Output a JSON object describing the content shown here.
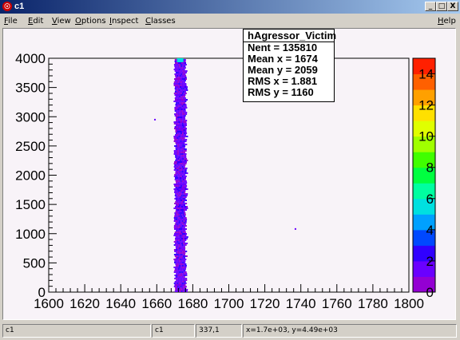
{
  "window": {
    "title": "c1",
    "min_label": "_",
    "max_label": "□",
    "close_label": "X"
  },
  "menu": {
    "file": "File",
    "edit": "Edit",
    "view": "View",
    "options": "Options",
    "inspect": "Inspect",
    "classes": "Classes",
    "help": "Help"
  },
  "stats": {
    "title": "hAgressor_Victim",
    "nent": "Nent = 135810",
    "mean_x": "Mean x =   1674",
    "mean_y": "Mean y =   2059",
    "rms_x": "RMS x  =  1.881",
    "rms_y": "RMS y  =   1160"
  },
  "status": {
    "object": "c1",
    "pad": "c1",
    "pixel": "337,1",
    "coords": "x=1.7e+03, y=4.49e+03"
  },
  "chart_data": {
    "type": "heatmap",
    "title": "",
    "xlabel": "",
    "ylabel": "",
    "xlim": [
      1600,
      1800
    ],
    "ylim": [
      0,
      4000
    ],
    "x_ticks": [
      "1600",
      "1620",
      "1640",
      "1660",
      "1680",
      "1700",
      "1720",
      "1740",
      "1760",
      "1780",
      "1800"
    ],
    "y_ticks": [
      "0",
      "500",
      "1000",
      "1500",
      "2000",
      "2500",
      "3000",
      "3500",
      "4000"
    ],
    "z_ticks": [
      "0",
      "2",
      "4",
      "6",
      "8",
      "10",
      "12",
      "14"
    ],
    "zlim": [
      0,
      15
    ],
    "band": {
      "x_min": 1670,
      "x_max": 1676,
      "y_min": 0,
      "y_max": 4000,
      "typical_z": 1.5
    },
    "hotspot": {
      "x": 1673,
      "y": 3960,
      "z": 5
    },
    "outliers": [
      {
        "x": 1659,
        "y": 2950,
        "z": 1
      },
      {
        "x": 1737,
        "y": 1080,
        "z": 1
      }
    ],
    "palette": [
      "#9400d3",
      "#6a00ff",
      "#3000ff",
      "#0048ff",
      "#00a0ff",
      "#00e0e0",
      "#00ffa0",
      "#00ff40",
      "#40ff00",
      "#a0ff00",
      "#e0ff00",
      "#ffe000",
      "#ffa000",
      "#ff6000",
      "#ff2000"
    ],
    "grid": false
  }
}
